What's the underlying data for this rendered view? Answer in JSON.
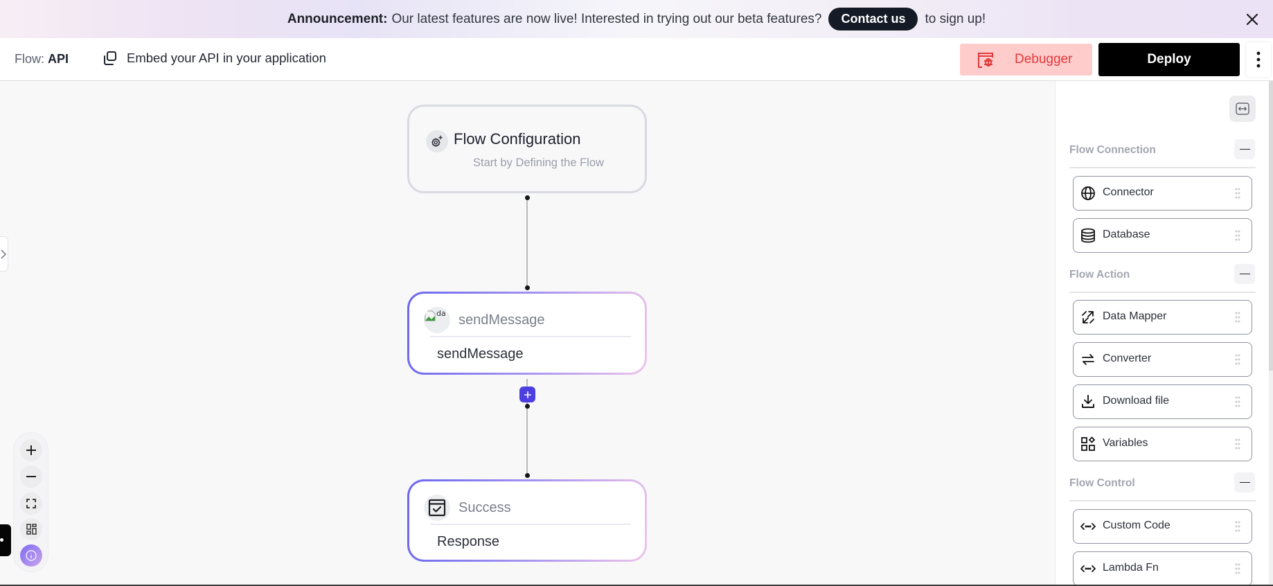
{
  "announcement": {
    "label": "Announcement:",
    "message": "Our latest features are now live! Interested in trying out our beta features?",
    "cta": "Contact us",
    "tail": "to sign up!",
    "close_icon": "close-icon"
  },
  "header": {
    "flow_prefix": "Flow:",
    "flow_name": "API",
    "embed_label": "Embed your API in your application",
    "debugger_label": "Debugger",
    "deploy_label": "Deploy",
    "colors": {
      "debugger_bg": "#ffcccc",
      "debugger_text": "#e03a3a",
      "deploy_bg": "#000000"
    }
  },
  "canvas": {
    "nodes": [
      {
        "id": "config",
        "title": "Flow Configuration",
        "subtitle": "Start by Defining the Flow",
        "icon": "settings-sparkle-icon"
      },
      {
        "id": "sendMessage",
        "header": "sendMessage",
        "body": "sendMessage",
        "icon": "broken-image-icon",
        "icon_alt": "da"
      },
      {
        "id": "success",
        "header": "Success",
        "body": "Response",
        "icon": "calendar-check-icon"
      }
    ],
    "add_button_label": "+",
    "controls": [
      "zoom-in",
      "zoom-out",
      "fit-view",
      "minimap",
      "info"
    ],
    "accent": "#4c3fe0"
  },
  "sidebar": {
    "sections": [
      {
        "title": "Flow Connection",
        "items": [
          {
            "label": "Connector",
            "icon": "globe-icon"
          },
          {
            "label": "Database",
            "icon": "database-icon"
          }
        ]
      },
      {
        "title": "Flow Action",
        "items": [
          {
            "label": "Data Mapper",
            "icon": "data-mapper-icon"
          },
          {
            "label": "Converter",
            "icon": "converter-icon"
          },
          {
            "label": "Download file",
            "icon": "download-icon"
          },
          {
            "label": "Variables",
            "icon": "variables-icon"
          }
        ]
      },
      {
        "title": "Flow Control",
        "items": [
          {
            "label": "Custom Code",
            "icon": "code-icon"
          },
          {
            "label": "Lambda Fn",
            "icon": "code-icon"
          }
        ]
      }
    ]
  }
}
